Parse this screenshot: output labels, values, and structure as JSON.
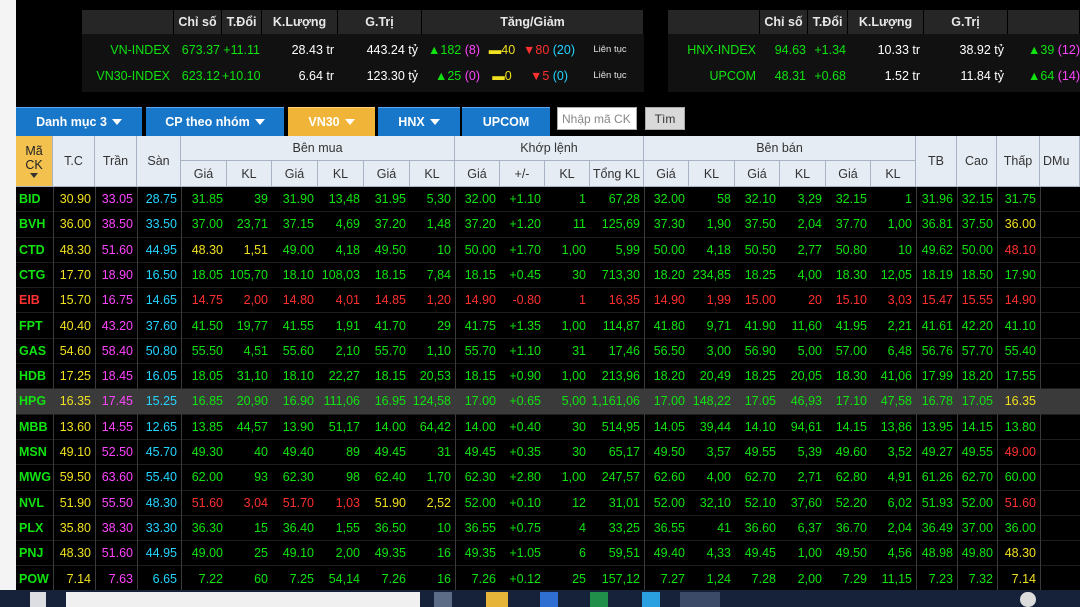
{
  "indices_header": [
    "Chỉ số",
    "T.Đổi",
    "K.Lượng",
    "G.Trị",
    "Tăng/Giảm"
  ],
  "indices_header_right": [
    "Chỉ số",
    "T.Đổi",
    "K.Lượng",
    "G.Trị"
  ],
  "indices_left": [
    {
      "name": "VN-INDEX",
      "value": "673.37",
      "change": "+11.11",
      "volume": "28.43 tr",
      "valuetrade": "443.24 tỷ",
      "up": "182",
      "up_ceil": "(8)",
      "same": "40",
      "down": "80",
      "down_floor": "(20)",
      "status": "Liên tục"
    },
    {
      "name": "VN30-INDEX",
      "value": "623.12",
      "change": "+10.10",
      "volume": "6.64 tr",
      "valuetrade": "123.30 tỷ",
      "up": "25",
      "up_ceil": "(0)",
      "same": "0",
      "down": "5",
      "down_floor": "(0)",
      "status": "Liên tục"
    }
  ],
  "indices_right": [
    {
      "name": "HNX-INDEX",
      "value": "94.63",
      "change": "+1.34",
      "volume": "10.33 tr",
      "valuetrade": "38.92 tỷ",
      "up": "39",
      "up_ceil": "(12)"
    },
    {
      "name": "UPCOM",
      "value": "48.31",
      "change": "+0.68",
      "volume": "1.52 tr",
      "valuetrade": "11.84 tỷ",
      "up": "64",
      "up_ceil": "(14)"
    }
  ],
  "tabs": [
    {
      "label": "Danh mục 3",
      "dropdown": true,
      "selected": false
    },
    {
      "label": "CP theo nhóm",
      "dropdown": true,
      "selected": false
    },
    {
      "label": "VN30",
      "dropdown": true,
      "selected": true
    },
    {
      "label": "HNX",
      "dropdown": true,
      "selected": false
    },
    {
      "label": "UPCOM",
      "dropdown": false,
      "selected": false
    }
  ],
  "search": {
    "placeholder": "Nhập mã CK",
    "button": "Tìm"
  },
  "table": {
    "groups": {
      "ma": "Mã CK",
      "tc": "T.C",
      "tran": "Trần",
      "san": "Sàn",
      "benmua": "Bên mua",
      "khop": "Khớp lệnh",
      "benban": "Bên bán",
      "tb": "TB",
      "cao": "Cao",
      "thap": "Thấp",
      "dmu": "DMu"
    },
    "sub": {
      "gia": "Giá",
      "kl": "KL",
      "pm": "+/-",
      "tongkl": "Tổng KL"
    },
    "rows": [
      [
        "BID",
        "30.90",
        "33.05",
        "28.75",
        "31.85",
        "39",
        "31.90",
        "13,48",
        "31.95",
        "5,30",
        "32.00",
        "+1.10",
        "1",
        "67,28",
        "32.00",
        "58",
        "32.10",
        "3,29",
        "32.15",
        "1",
        "31.96",
        "32.15",
        "31.75"
      ],
      [
        "BVH",
        "36.00",
        "38.50",
        "33.50",
        "37.00",
        "23,71",
        "37.15",
        "4,69",
        "37.20",
        "1,48",
        "37.20",
        "+1.20",
        "11",
        "125,69",
        "37.30",
        "1,90",
        "37.50",
        "2,04",
        "37.70",
        "1,00",
        "36.81",
        "37.50",
        "36.00"
      ],
      [
        "CTD",
        "48.30",
        "51.60",
        "44.95",
        "48.30",
        "1,51",
        "49.00",
        "4,18",
        "49.50",
        "10",
        "50.00",
        "+1.70",
        "1,00",
        "5,99",
        "50.00",
        "4,18",
        "50.50",
        "2,77",
        "50.80",
        "10",
        "49.62",
        "50.00",
        "48.10"
      ],
      [
        "CTG",
        "17.70",
        "18.90",
        "16.50",
        "18.05",
        "105,70",
        "18.10",
        "108,03",
        "18.15",
        "7,84",
        "18.15",
        "+0.45",
        "30",
        "713,30",
        "18.20",
        "234,85",
        "18.25",
        "4,00",
        "18.30",
        "12,05",
        "18.19",
        "18.50",
        "17.90"
      ],
      [
        "EIB",
        "15.70",
        "16.75",
        "14.65",
        "14.75",
        "2,00",
        "14.80",
        "4,01",
        "14.85",
        "1,20",
        "14.90",
        "-0.80",
        "1",
        "16,35",
        "14.90",
        "1,99",
        "15.00",
        "20",
        "15.10",
        "3,03",
        "15.47",
        "15.55",
        "14.90"
      ],
      [
        "FPT",
        "40.40",
        "43.20",
        "37.60",
        "41.50",
        "19,77",
        "41.55",
        "1,91",
        "41.70",
        "29",
        "41.75",
        "+1.35",
        "1,00",
        "114,87",
        "41.80",
        "9,71",
        "41.90",
        "11,60",
        "41.95",
        "2,21",
        "41.61",
        "42.20",
        "41.10"
      ],
      [
        "GAS",
        "54.60",
        "58.40",
        "50.80",
        "55.50",
        "4,51",
        "55.60",
        "2,10",
        "55.70",
        "1,10",
        "55.70",
        "+1.10",
        "31",
        "17,46",
        "56.50",
        "3,00",
        "56.90",
        "5,00",
        "57.00",
        "6,48",
        "56.76",
        "57.70",
        "55.40"
      ],
      [
        "HDB",
        "17.25",
        "18.45",
        "16.05",
        "18.05",
        "31,10",
        "18.10",
        "22,27",
        "18.15",
        "20,53",
        "18.15",
        "+0.90",
        "1,00",
        "213,96",
        "18.20",
        "20,49",
        "18.25",
        "20,05",
        "18.30",
        "41,06",
        "17.99",
        "18.20",
        "17.55"
      ],
      [
        "HPG",
        "16.35",
        "17.45",
        "15.25",
        "16.85",
        "20,90",
        "16.90",
        "111,06",
        "16.95",
        "124,58",
        "17.00",
        "+0.65",
        "5,00",
        "1,161,06",
        "17.00",
        "148,22",
        "17.05",
        "46,93",
        "17.10",
        "47,58",
        "16.78",
        "17.05",
        "16.35"
      ],
      [
        "MBB",
        "13.60",
        "14.55",
        "12.65",
        "13.85",
        "44,57",
        "13.90",
        "51,17",
        "14.00",
        "64,42",
        "14.00",
        "+0.40",
        "30",
        "514,95",
        "14.05",
        "39,44",
        "14.10",
        "94,61",
        "14.15",
        "13,86",
        "13.95",
        "14.15",
        "13.80"
      ],
      [
        "MSN",
        "49.10",
        "52.50",
        "45.70",
        "49.30",
        "40",
        "49.40",
        "89",
        "49.45",
        "31",
        "49.45",
        "+0.35",
        "30",
        "65,17",
        "49.50",
        "3,57",
        "49.55",
        "5,39",
        "49.60",
        "3,52",
        "49.27",
        "49.55",
        "49.00"
      ],
      [
        "MWG",
        "59.50",
        "63.60",
        "55.40",
        "62.00",
        "93",
        "62.30",
        "98",
        "62.40",
        "1,70",
        "62.30",
        "+2.80",
        "1,00",
        "247,57",
        "62.60",
        "4,00",
        "62.70",
        "2,71",
        "62.80",
        "4,91",
        "61.26",
        "62.70",
        "60.00"
      ],
      [
        "NVL",
        "51.90",
        "55.50",
        "48.30",
        "51.60",
        "3,04",
        "51.70",
        "1,03",
        "51.90",
        "2,52",
        "52.00",
        "+0.10",
        "12",
        "31,01",
        "52.00",
        "32,10",
        "52.10",
        "37,60",
        "52.20",
        "6,02",
        "51.93",
        "52.00",
        "51.60"
      ],
      [
        "PLX",
        "35.80",
        "38.30",
        "33.30",
        "36.30",
        "15",
        "36.40",
        "1,55",
        "36.50",
        "10",
        "36.55",
        "+0.75",
        "4",
        "33,25",
        "36.55",
        "41",
        "36.60",
        "6,37",
        "36.70",
        "2,04",
        "36.49",
        "37.00",
        "36.00"
      ],
      [
        "PNJ",
        "48.30",
        "51.60",
        "44.95",
        "49.00",
        "25",
        "49.10",
        "2,00",
        "49.35",
        "16",
        "49.35",
        "+1.05",
        "6",
        "59,51",
        "49.40",
        "4,33",
        "49.45",
        "1,00",
        "49.50",
        "4,56",
        "48.98",
        "49.80",
        "48.30"
      ],
      [
        "POW",
        "7.14",
        "7.63",
        "6.65",
        "7.22",
        "60",
        "7.25",
        "54,14",
        "7.26",
        "16",
        "7.26",
        "+0.12",
        "25",
        "157,12",
        "7.27",
        "1,24",
        "7.28",
        "2,00",
        "7.29",
        "11,15",
        "7.23",
        "7.32",
        "7.14"
      ]
    ]
  },
  "colors": {
    "up": "#11e311",
    "ref": "#f0e020",
    "down": "#ff3030",
    "ceil": "#ff44ff",
    "floor": "#23d5ff",
    "tab": "#1877c8",
    "tab_selected": "#f0b438"
  }
}
